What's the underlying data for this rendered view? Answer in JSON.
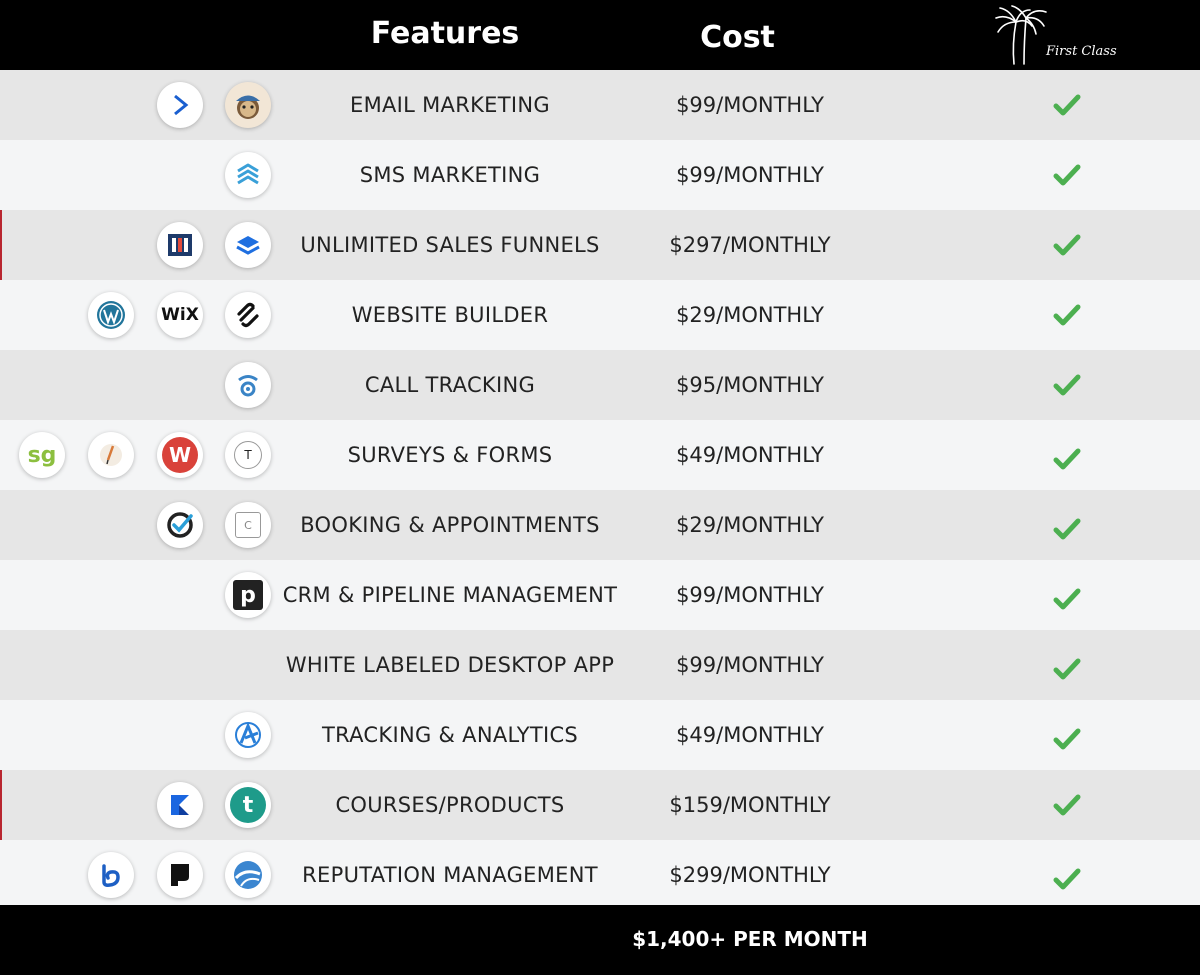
{
  "header": {
    "features_label": "Features",
    "cost_label": "Cost",
    "brand_text": "First Class"
  },
  "rows": [
    {
      "feature": "EMAIL MARKETING",
      "cost": "$99/MONTHLY",
      "icons": [
        "activecampaign-icon",
        "mailchimp-icon"
      ]
    },
    {
      "feature": "SMS MARKETING",
      "cost": "$99/MONTHLY",
      "icons": [
        "sms-stack-icon"
      ]
    },
    {
      "feature": "UNLIMITED SALES FUNNELS",
      "cost": "$297/MONTHLY",
      "icons": [
        "clickfunnels-icon",
        "leadpages-icon"
      ]
    },
    {
      "feature": "WEBSITE BUILDER",
      "cost": "$29/MONTHLY",
      "icons": [
        "wordpress-icon",
        "wix-icon",
        "squarespace-icon"
      ]
    },
    {
      "feature": "CALL TRACKING",
      "cost": "$95/MONTHLY",
      "icons": [
        "call-tracking-icon"
      ]
    },
    {
      "feature": "SURVEYS & FORMS",
      "cost": "$49/MONTHLY",
      "icons": [
        "surveygizmo-icon",
        "quill-icon",
        "wufoo-icon",
        "typeform-icon"
      ]
    },
    {
      "feature": "BOOKING & APPOINTMENTS",
      "cost": "$29/MONTHLY",
      "icons": [
        "acuity-icon",
        "calendar-icon"
      ]
    },
    {
      "feature": "CRM & PIPELINE MANAGEMENT",
      "cost": "$99/MONTHLY",
      "icons": [
        "pipedrive-icon"
      ]
    },
    {
      "feature": "WHITE LABELED DESKTOP APP",
      "cost": "$99/MONTHLY",
      "icons": []
    },
    {
      "feature": "TRACKING & ANALYTICS",
      "cost": "$49/MONTHLY",
      "icons": [
        "analytics-icon"
      ]
    },
    {
      "feature": "COURSES/PRODUCTS",
      "cost": "$159/MONTHLY",
      "icons": [
        "kajabi-icon",
        "teachable-icon"
      ]
    },
    {
      "feature": "REPUTATION MANAGEMENT",
      "cost": "$299/MONTHLY",
      "icons": [
        "birdeye-icon",
        "podium-icon",
        "swell-icon"
      ]
    }
  ],
  "icon_text": {
    "wix": "WiX",
    "surveygizmo": "sg",
    "typeform": "T",
    "teachable": "t",
    "pipedrive": "p",
    "wufoo": "W",
    "calendar": "C"
  },
  "footer": {
    "total": "$1,400+ PER MONTH"
  },
  "colors": {
    "check": "#4caf50",
    "row_dark": "#e6e6e6",
    "row_light": "#f4f5f6",
    "header_bg": "#000000"
  }
}
